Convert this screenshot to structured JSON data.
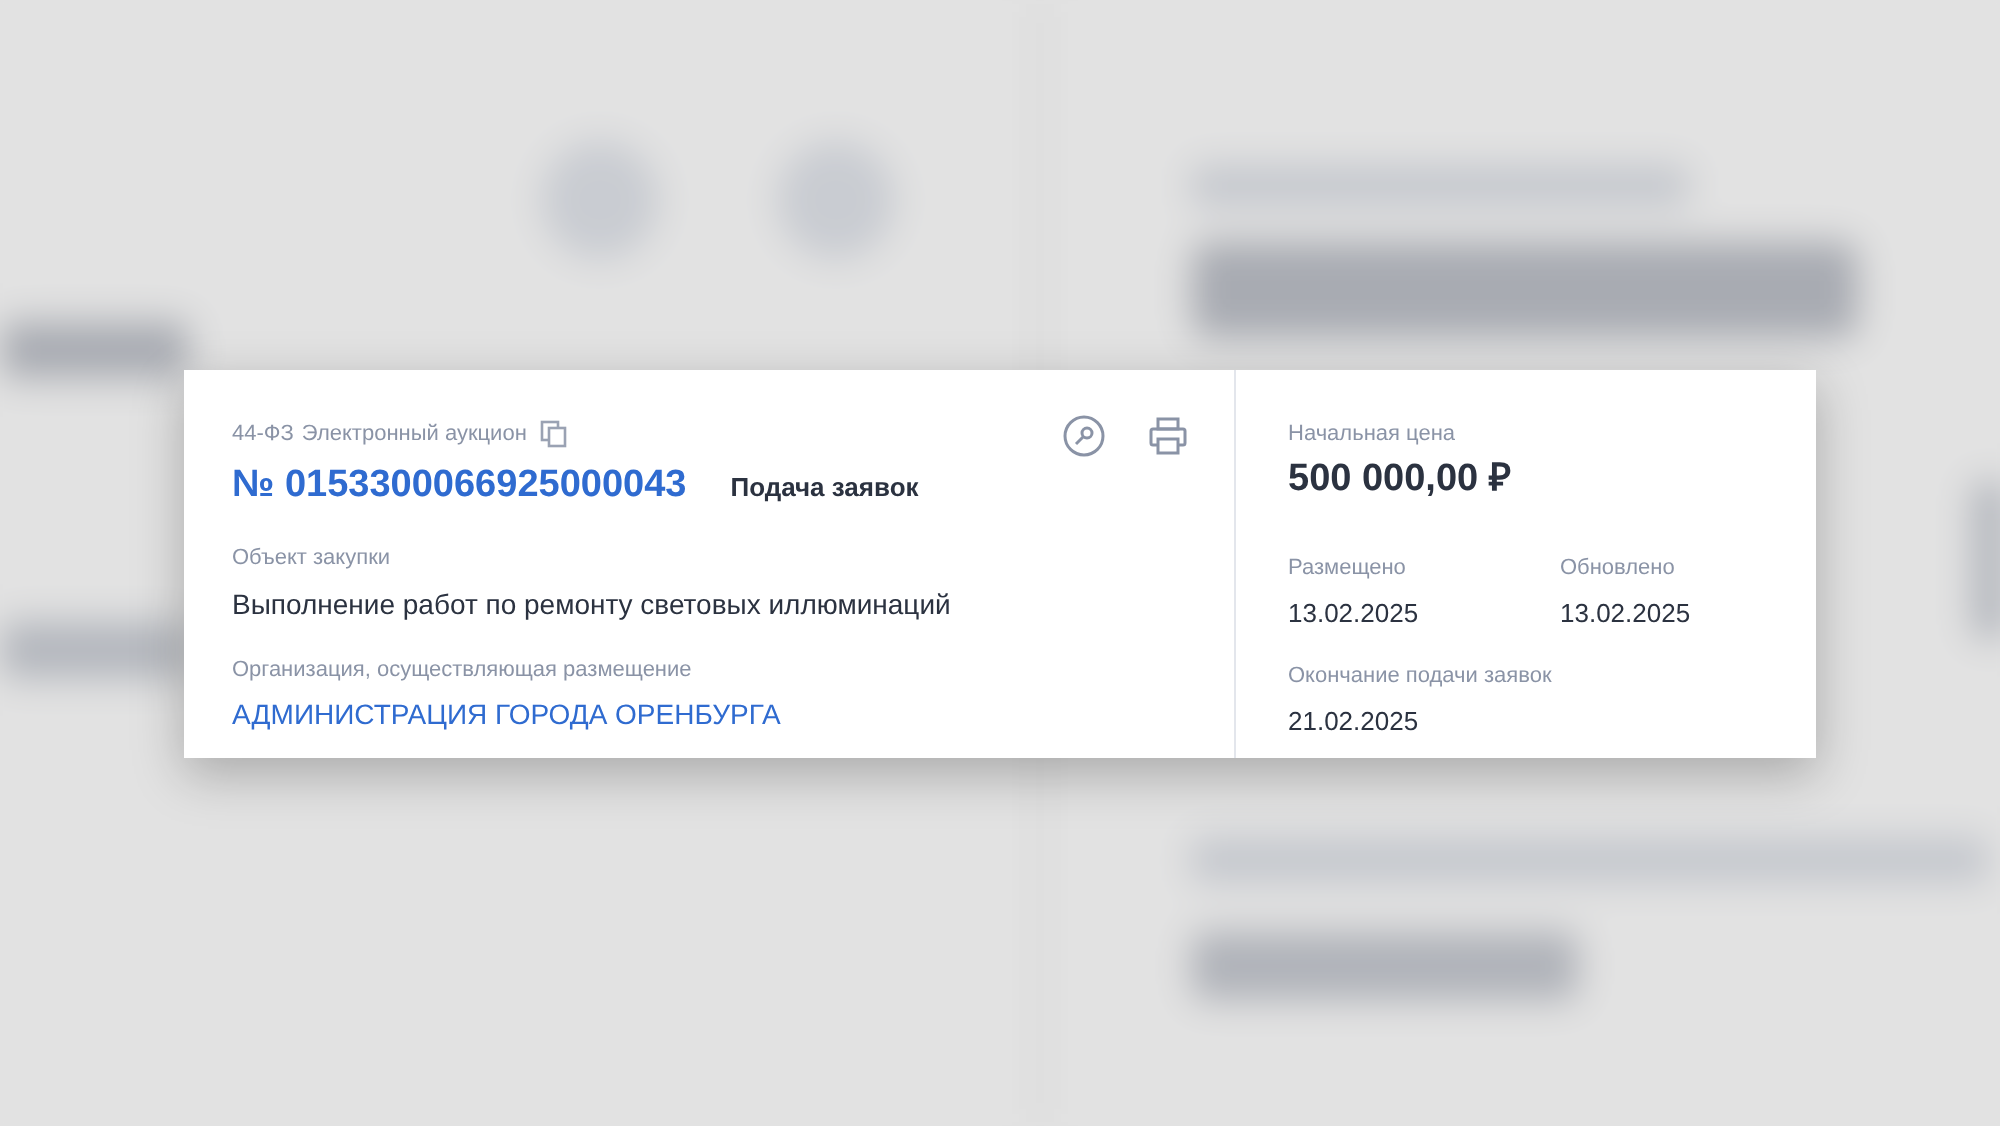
{
  "card": {
    "law": "44-ФЗ",
    "procedure": "Электронный аукцион",
    "number": "№ 0153300066925000043",
    "stage": "Подача заявок",
    "fields": [
      {
        "label": "Объект закупки",
        "value": "Выполнение работ по ремонту световых иллюминаций",
        "kind": "text"
      },
      {
        "label": "Организация, осуществляющая размещение",
        "value": "АДМИНИСТРАЦИЯ ГОРОДА ОРЕНБУРГА",
        "kind": "link"
      }
    ],
    "price": {
      "label": "Начальная цена",
      "value": "500 000,00 ₽"
    },
    "dates": [
      {
        "label": "Размещено",
        "value": "13.02.2025"
      },
      {
        "label": "Обновлено",
        "value": "13.02.2025"
      },
      {
        "label": "Окончание подачи заявок",
        "value": "21.02.2025"
      }
    ]
  }
}
